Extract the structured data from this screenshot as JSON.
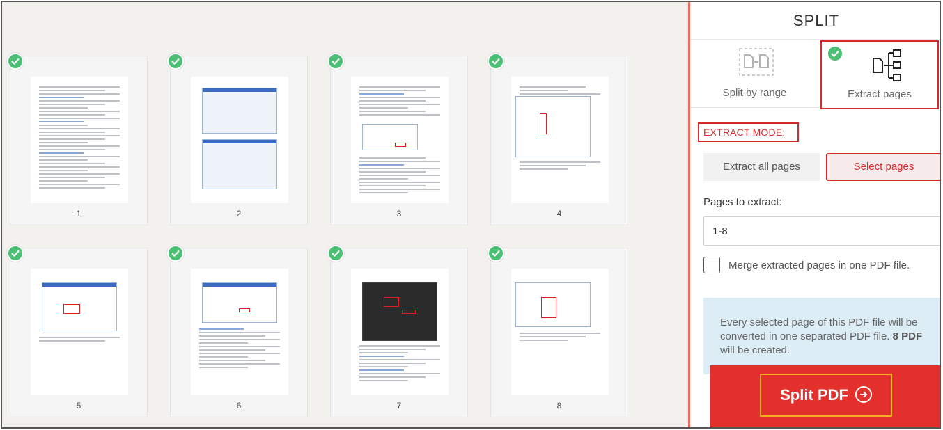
{
  "panel": {
    "title": "SPLIT",
    "modes": [
      {
        "label": "Split by range",
        "icon": "split-range-icon",
        "selected": false
      },
      {
        "label": "Extract pages",
        "icon": "extract-pages-icon",
        "selected": true
      }
    ],
    "extract_mode_label": "EXTRACT MODE:",
    "extract_options": [
      {
        "label": "Extract all pages",
        "selected": false
      },
      {
        "label": "Select pages",
        "selected": true
      }
    ],
    "pages_label": "Pages to extract:",
    "pages_value": "1-8",
    "merge_label": "Merge extracted pages in one PDF file.",
    "merge_checked": false,
    "info_text_1": "Every selected page of this PDF file will be converted in one separated PDF file.",
    "info_count": "8 PDF",
    "info_text_2": " will be created.",
    "split_button": "Split PDF"
  },
  "pages": [
    {
      "number": "1",
      "selected": true
    },
    {
      "number": "2",
      "selected": true
    },
    {
      "number": "3",
      "selected": true
    },
    {
      "number": "4",
      "selected": true
    },
    {
      "number": "5",
      "selected": true
    },
    {
      "number": "6",
      "selected": true
    },
    {
      "number": "7",
      "selected": true
    },
    {
      "number": "8",
      "selected": true
    }
  ],
  "colors": {
    "accent_red": "#e4302c",
    "check_green": "#4bbf73",
    "highlight_yellow": "#f2b21f"
  }
}
